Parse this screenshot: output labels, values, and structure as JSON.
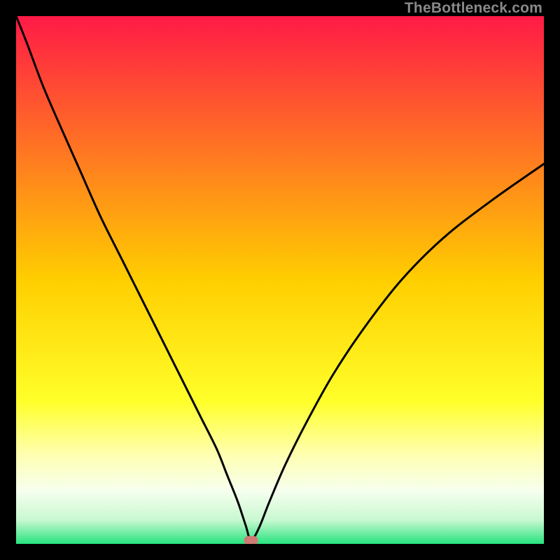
{
  "watermark": "TheBottleneck.com",
  "chart_data": {
    "type": "line",
    "title": "",
    "xlabel": "",
    "ylabel": "",
    "xlim": [
      0,
      100
    ],
    "ylim": [
      0,
      100
    ],
    "grid": false,
    "background_gradient": {
      "stops": [
        {
          "offset": 0.0,
          "color": "#ff1a46"
        },
        {
          "offset": 0.5,
          "color": "#ffce00"
        },
        {
          "offset": 0.73,
          "color": "#ffff2a"
        },
        {
          "offset": 0.83,
          "color": "#ffffb0"
        },
        {
          "offset": 0.9,
          "color": "#f6ffef"
        },
        {
          "offset": 0.955,
          "color": "#c8f8d0"
        },
        {
          "offset": 1.0,
          "color": "#26e37e"
        }
      ]
    },
    "marker": {
      "x": 44.5,
      "y": 0.7,
      "color": "#cf7a72"
    },
    "series": [
      {
        "name": "curve",
        "type": "line",
        "x": [
          0,
          2,
          5,
          8,
          12,
          16,
          20,
          24,
          28,
          32,
          35,
          38,
          40,
          42,
          43.5,
          44.5,
          46,
          48,
          51,
          55,
          60,
          66,
          73,
          81,
          90,
          100
        ],
        "values": [
          100,
          95,
          87,
          80,
          71,
          62,
          54,
          46,
          38,
          30,
          24,
          18,
          13,
          8,
          3.5,
          0.7,
          3,
          8,
          15,
          23,
          32,
          41,
          50,
          58,
          65,
          72
        ]
      }
    ]
  }
}
